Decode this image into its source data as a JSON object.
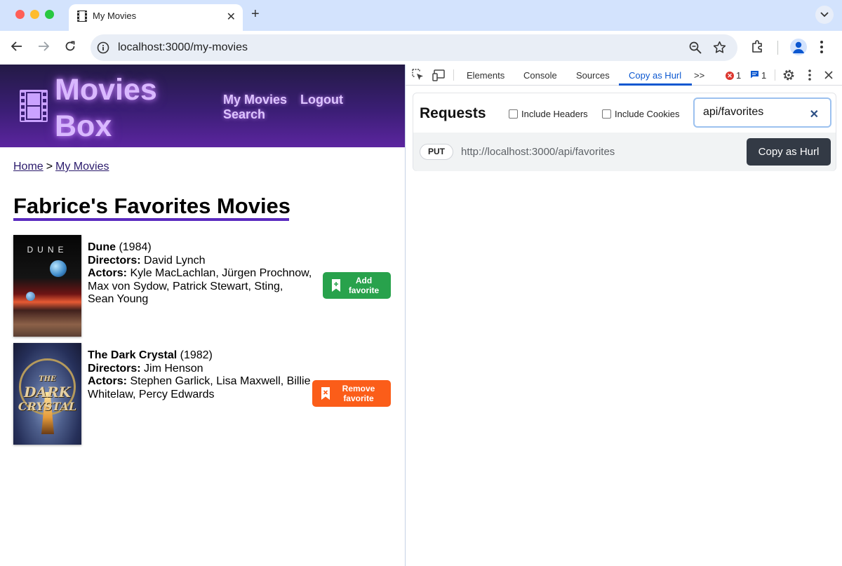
{
  "browser": {
    "tab_title": "My Movies",
    "new_tab_label": "+",
    "url": "localhost:3000/my-movies"
  },
  "site": {
    "logo_line1": "Movies",
    "logo_line2": "Box",
    "nav": {
      "my_movies": "My Movies",
      "logout": "Logout",
      "search": "Search"
    },
    "breadcrumb": {
      "home": "Home",
      "separator": ">",
      "current": "My Movies"
    },
    "page_title": "Fabrice's Favorites Movies",
    "labels": {
      "directors": "Directors:",
      "actors": "Actors:"
    },
    "movies": [
      {
        "poster_text": "DUNE",
        "title": "Dune",
        "year": "(1984)",
        "directors": "David Lynch",
        "actors": "Kyle MacLachlan, Jürgen Prochnow, Max von Sydow, Patrick Stewart, Sting, Sean Young",
        "button_line1": "Add",
        "button_line2": "favorite",
        "button_color": "#28a24c"
      },
      {
        "poster_text_1": "THE",
        "poster_text_2": "DARK",
        "poster_text_3": "CRYSTAL",
        "title": "The Dark Crystal",
        "year": "(1982)",
        "directors": "Jim Henson",
        "actors": "Stephen Garlick, Lisa Maxwell, Billie Whitelaw, Percy Edwards",
        "button_line1": "Remove",
        "button_line2": "favorite",
        "button_color": "#fb5d19"
      }
    ]
  },
  "devtools": {
    "tabs": [
      "Elements",
      "Console",
      "Sources",
      "Copy as Hurl"
    ],
    "active_tab": "Copy as Hurl",
    "more_tabs": ">>",
    "error_count": "1",
    "message_count": "1",
    "panel": {
      "title": "Requests",
      "include_headers": "Include Headers",
      "include_cookies": "Include Cookies",
      "filter_value": "api/favorites",
      "clear_label": "✕",
      "request": {
        "method": "PUT",
        "url": "http://localhost:3000/api/favorites",
        "copy_label": "Copy as Hurl"
      }
    }
  }
}
